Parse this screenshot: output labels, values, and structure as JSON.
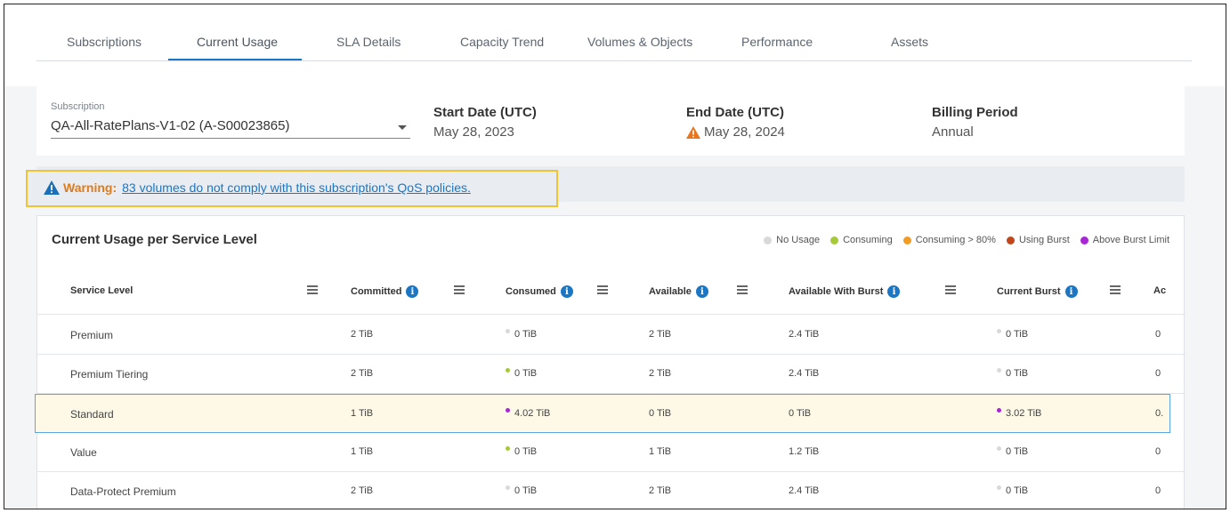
{
  "tabs": [
    {
      "label": "Subscriptions"
    },
    {
      "label": "Current Usage"
    },
    {
      "label": "SLA Details"
    },
    {
      "label": "Capacity Trend"
    },
    {
      "label": "Volumes & Objects"
    },
    {
      "label": "Performance"
    },
    {
      "label": "Assets"
    }
  ],
  "active_tab": "Current Usage",
  "subscription": {
    "label": "Subscription",
    "value": "QA-All-RatePlans-V1-02 (A-S00023865)"
  },
  "start_date": {
    "title": "Start Date (UTC)",
    "value": "May 28, 2023"
  },
  "end_date": {
    "title": "End Date (UTC)",
    "value": "May 28, 2024"
  },
  "billing_period": {
    "title": "Billing Period",
    "value": "Annual"
  },
  "warning": {
    "label": "Warning:",
    "link_text": "83 volumes do not comply with this subscription's QoS policies."
  },
  "usage": {
    "title": "Current Usage per Service Level",
    "legend": [
      {
        "label": "No Usage",
        "color": "#d9d9d9"
      },
      {
        "label": "Consuming",
        "color": "#a6c93a"
      },
      {
        "label": "Consuming > 80%",
        "color": "#f39c25"
      },
      {
        "label": "Using Burst",
        "color": "#c0461c"
      },
      {
        "label": "Above Burst Limit",
        "color": "#a926d6"
      }
    ],
    "columns": [
      {
        "label": "Service Level"
      },
      {
        "label": "Committed"
      },
      {
        "label": "Consumed"
      },
      {
        "label": "Available"
      },
      {
        "label": "Available With Burst"
      },
      {
        "label": "Current Burst"
      },
      {
        "label": "Ac"
      }
    ],
    "rows": [
      {
        "service": "Premium",
        "committed": "2 TiB",
        "consumed": "0 TiB",
        "consumed_status": "#d9d9d9",
        "available": "2 TiB",
        "available_burst": "2.4 TiB",
        "current_burst": "0 TiB",
        "burst_status": "#d9d9d9",
        "extra": "0"
      },
      {
        "service": "Premium Tiering",
        "committed": "2 TiB",
        "consumed": "0 TiB",
        "consumed_status": "#a6c93a",
        "available": "2 TiB",
        "available_burst": "2.4 TiB",
        "current_burst": "0 TiB",
        "burst_status": "#d9d9d9",
        "extra": "0"
      },
      {
        "service": "Standard",
        "committed": "1 TiB",
        "consumed": "4.02 TiB",
        "consumed_status": "#a926d6",
        "available": "0 TiB",
        "available_burst": "0 TiB",
        "current_burst": "3.02 TiB",
        "burst_status": "#a926d6",
        "extra": "0."
      },
      {
        "service": "Value",
        "committed": "1 TiB",
        "consumed": "0 TiB",
        "consumed_status": "#a6c93a",
        "available": "1 TiB",
        "available_burst": "1.2 TiB",
        "current_burst": "0 TiB",
        "burst_status": "#d9d9d9",
        "extra": "0"
      },
      {
        "service": "Data-Protect Premium",
        "committed": "2 TiB",
        "consumed": "0 TiB",
        "consumed_status": "#d9d9d9",
        "available": "2 TiB",
        "available_burst": "2.4 TiB",
        "current_burst": "0 TiB",
        "burst_status": "#d9d9d9",
        "extra": "0"
      }
    ],
    "selected_row": 2
  }
}
